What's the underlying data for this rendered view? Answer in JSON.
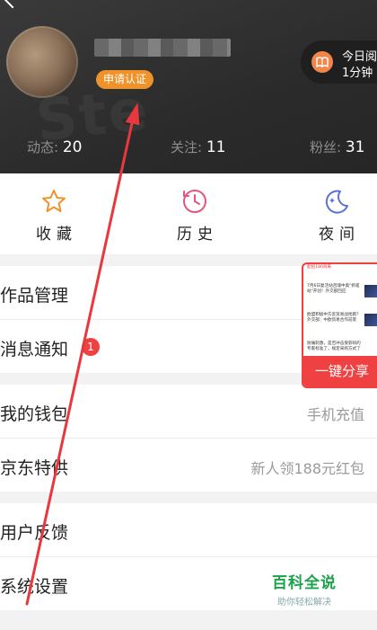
{
  "profile": {
    "verify_badge": "申请认证",
    "reading": {
      "title": "今日阅",
      "time": "1分钟"
    },
    "watermark_text": "Ste"
  },
  "stats": [
    {
      "label": "动态",
      "value": "20"
    },
    {
      "label": "关注",
      "value": "11"
    },
    {
      "label": "粉丝",
      "value": "31"
    }
  ],
  "quick_actions": [
    {
      "label": "收藏",
      "icon": "star-icon"
    },
    {
      "label": "历史",
      "icon": "history-icon"
    },
    {
      "label": "夜间",
      "icon": "moon-icon"
    }
  ],
  "menu": {
    "works": "作品管理",
    "messages": {
      "label": "消息通知",
      "badge": "1"
    },
    "wallet": {
      "label": "我的钱包",
      "value": "手机充值"
    },
    "jd": {
      "label": "京东特供",
      "value": "新人领188元红包"
    },
    "feedback": "用户反馈",
    "settings": "系统设置"
  },
  "share_card": {
    "news": [
      "起招180商来",
      "7月6日复活站吕魂中奥\"抓嗟站\"开创！外交部回应",
      "欧盟积极中方反贸易战抢跑？外交部：中欧贸易合作前景",
      "防痛刺激，是否冲击受影响的专家标准了，规定采购方式了"
    ],
    "button": "一键分享"
  },
  "logo": {
    "main": "百科全说",
    "sub": "助你轻松解决"
  },
  "colors": {
    "accent_red": "#f04142",
    "badge_orange": "#f0922a",
    "logo_green": "#1aa34a"
  }
}
